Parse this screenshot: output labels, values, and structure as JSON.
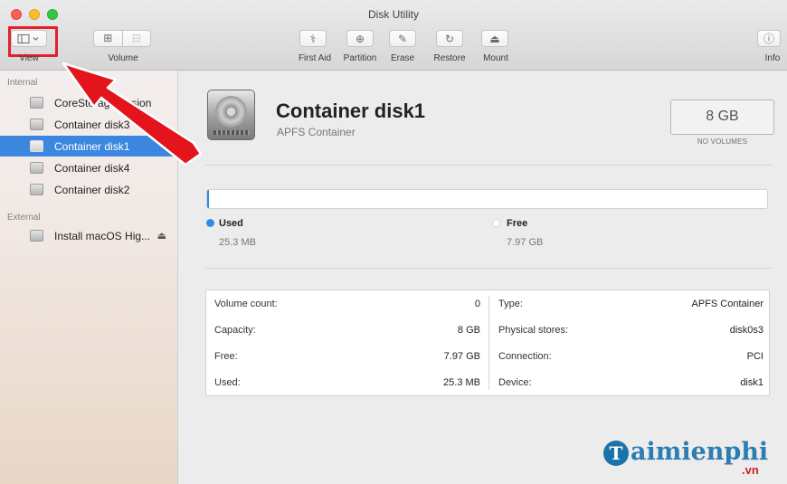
{
  "window": {
    "title": "Disk Utility"
  },
  "toolbar": {
    "view_label": "View",
    "volume_label": "Volume",
    "first_aid_label": "First Aid",
    "partition_label": "Partition",
    "erase_label": "Erase",
    "restore_label": "Restore",
    "mount_label": "Mount",
    "info_label": "Info",
    "icons": {
      "view": "sidebar-chevron-icon",
      "volume_add": "add-volume-icon",
      "volume_remove": "remove-volume-icon",
      "first_aid": "stethoscope-icon",
      "partition": "partition-pie-icon",
      "erase": "erase-icon",
      "restore": "restore-arrow-icon",
      "mount": "mount-icon",
      "info": "info-icon"
    }
  },
  "sidebar": {
    "internal_label": "Internal",
    "external_label": "External",
    "internal_items": [
      {
        "label": "CoreStorage Fusion",
        "selected": false
      },
      {
        "label": "Container disk3",
        "selected": false
      },
      {
        "label": "Container disk1",
        "selected": true
      },
      {
        "label": "Container disk4",
        "selected": false
      },
      {
        "label": "Container disk2",
        "selected": false
      }
    ],
    "external_items": [
      {
        "label": "Install macOS Hig...",
        "eject_icon": "eject-icon"
      }
    ]
  },
  "detail": {
    "name": "Container disk1",
    "subtitle": "APFS Container",
    "capacity": "8 GB",
    "capacity_note": "NO VOLUMES",
    "used_fraction": 0.003,
    "used_label": "Used",
    "used_value": "25.3 MB",
    "free_label": "Free",
    "free_value": "7.97 GB",
    "colors": {
      "used": "#2f8ce6",
      "selection": "#3b87e0"
    }
  },
  "info": {
    "left": [
      {
        "key": "Volume count:",
        "value": "0"
      },
      {
        "key": "Capacity:",
        "value": "8 GB"
      },
      {
        "key": "Free:",
        "value": "7.97 GB"
      },
      {
        "key": "Used:",
        "value": "25.3 MB"
      }
    ],
    "right": [
      {
        "key": "Type:",
        "value": "APFS Container"
      },
      {
        "key": "Physical stores:",
        "value": "disk0s3"
      },
      {
        "key": "Connection:",
        "value": "PCI"
      },
      {
        "key": "Device:",
        "value": "disk1"
      }
    ]
  },
  "watermark": {
    "brand": "aimienphi",
    "letter": "T",
    "suffix": ".vn"
  }
}
